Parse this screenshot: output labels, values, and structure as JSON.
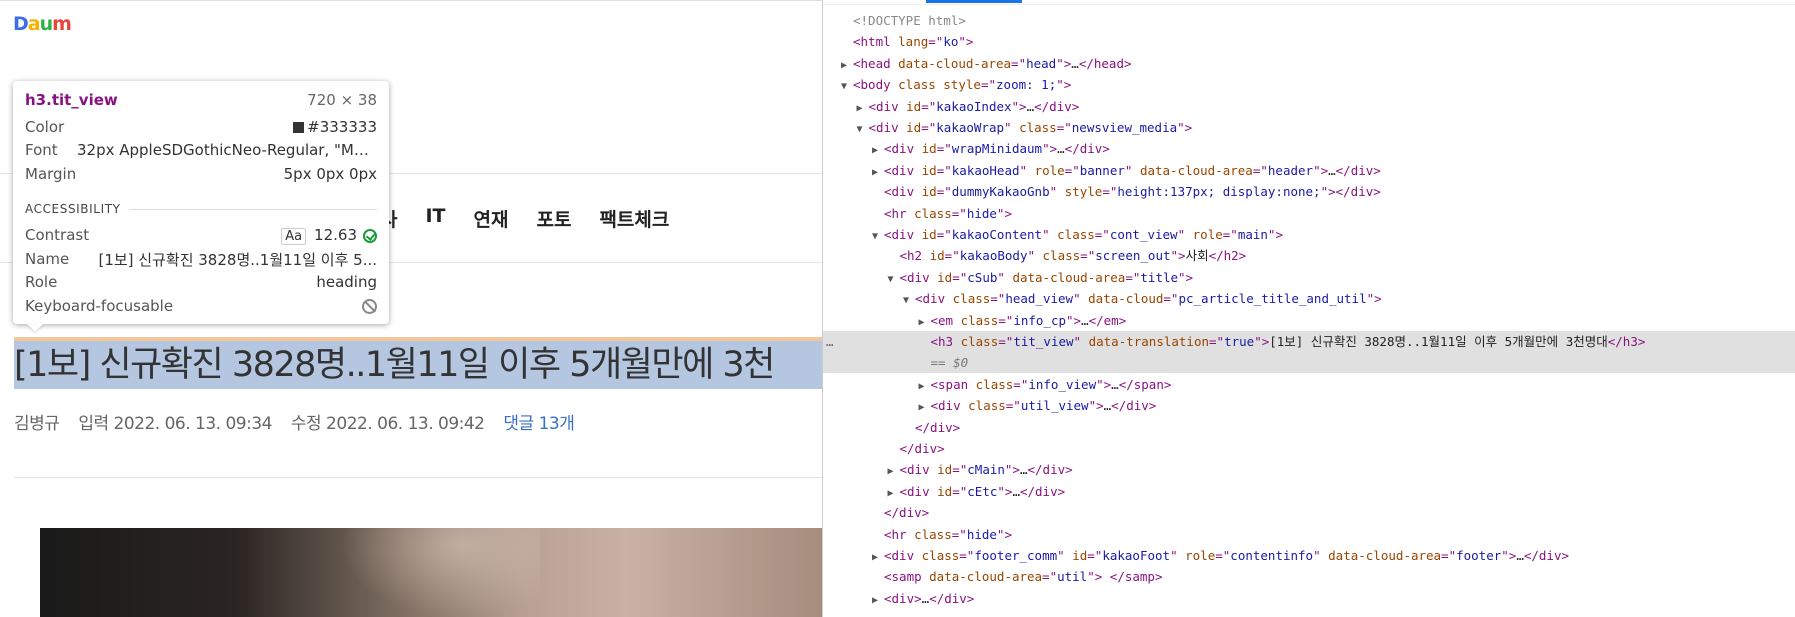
{
  "page": {
    "logo_letters": [
      "D",
      "a",
      "u",
      "m"
    ],
    "logo_colors": [
      "#3a6fe8",
      "#f5b100",
      "#2ab34a",
      "#e8453c"
    ],
    "nav": [
      "사",
      "IT",
      "연재",
      "포토",
      "팩트체크"
    ],
    "headline": "[1보] 신규확진 3828명..1월11일 이후 5개월만에 3천",
    "info": {
      "author": "김병규",
      "input": "입력 2022. 06. 13. 09:34",
      "modified": "수정 2022. 06. 13. 09:42",
      "comments": "댓글 13개"
    }
  },
  "tooltip": {
    "selector": "h3.tit_view",
    "size": "720 × 38",
    "color_label": "Color",
    "color_value": "#333333",
    "font_label": "Font",
    "font_value": "32px AppleSDGothicNeo-Regular, \"Malg...",
    "margin_label": "Margin",
    "margin_value": "5px 0px 0px",
    "accessibility_heading": "ACCESSIBILITY",
    "contrast_label": "Contrast",
    "contrast_aa": "Aa",
    "contrast_value": "12.63",
    "name_label": "Name",
    "name_value": "[1보] 신규확진 3828명..1월11일 이후 5...",
    "role_label": "Role",
    "role_value": "heading",
    "keyboard_label": "Keyboard-focusable"
  },
  "devtools": {
    "lines": [
      {
        "indent": 0,
        "tri": "",
        "parts": [
          [
            "cmt",
            "<!DOCTYPE html>"
          ]
        ]
      },
      {
        "indent": 0,
        "tri": "",
        "parts": [
          [
            "tag",
            "<html "
          ],
          [
            "attr",
            "lang"
          ],
          [
            "tag",
            "=\""
          ],
          [
            "val",
            "ko"
          ],
          [
            "tag",
            "\">"
          ]
        ]
      },
      {
        "indent": 0,
        "tri": "▶",
        "parts": [
          [
            "tag",
            "<head "
          ],
          [
            "attr",
            "data-cloud-area"
          ],
          [
            "tag",
            "=\""
          ],
          [
            "val",
            "head"
          ],
          [
            "tag",
            "\">"
          ],
          [
            "txt",
            "…"
          ],
          [
            "tag",
            "</head>"
          ]
        ]
      },
      {
        "indent": 0,
        "tri": "▼",
        "parts": [
          [
            "tag",
            "<body "
          ],
          [
            "attr",
            "class style"
          ],
          [
            "tag",
            "=\""
          ],
          [
            "val",
            "zoom: 1;"
          ],
          [
            "tag",
            "\">"
          ]
        ]
      },
      {
        "indent": 1,
        "tri": "▶",
        "parts": [
          [
            "tag",
            "<div "
          ],
          [
            "attr",
            "id"
          ],
          [
            "tag",
            "=\""
          ],
          [
            "val",
            "kakaoIndex"
          ],
          [
            "tag",
            "\">"
          ],
          [
            "txt",
            "…"
          ],
          [
            "tag",
            "</div>"
          ]
        ]
      },
      {
        "indent": 1,
        "tri": "▼",
        "parts": [
          [
            "tag",
            "<div "
          ],
          [
            "attr",
            "id"
          ],
          [
            "tag",
            "=\""
          ],
          [
            "val",
            "kakaoWrap"
          ],
          [
            "tag",
            "\" "
          ],
          [
            "attr",
            "class"
          ],
          [
            "tag",
            "=\""
          ],
          [
            "val",
            "newsview_media"
          ],
          [
            "tag",
            "\">"
          ]
        ]
      },
      {
        "indent": 2,
        "tri": "▶",
        "parts": [
          [
            "tag",
            "<div "
          ],
          [
            "attr",
            "id"
          ],
          [
            "tag",
            "=\""
          ],
          [
            "val",
            "wrapMinidaum"
          ],
          [
            "tag",
            "\">"
          ],
          [
            "txt",
            "…"
          ],
          [
            "tag",
            "</div>"
          ]
        ]
      },
      {
        "indent": 2,
        "tri": "▶",
        "parts": [
          [
            "tag",
            "<div "
          ],
          [
            "attr",
            "id"
          ],
          [
            "tag",
            "=\""
          ],
          [
            "val",
            "kakaoHead"
          ],
          [
            "tag",
            "\" "
          ],
          [
            "attr",
            "role"
          ],
          [
            "tag",
            "=\""
          ],
          [
            "val",
            "banner"
          ],
          [
            "tag",
            "\" "
          ],
          [
            "attr",
            "data-cloud-area"
          ],
          [
            "tag",
            "=\""
          ],
          [
            "val",
            "header"
          ],
          [
            "tag",
            "\">"
          ],
          [
            "txt",
            "…"
          ],
          [
            "tag",
            "</div>"
          ]
        ]
      },
      {
        "indent": 2,
        "tri": "",
        "parts": [
          [
            "tag",
            "<div "
          ],
          [
            "attr",
            "id"
          ],
          [
            "tag",
            "=\""
          ],
          [
            "val",
            "dummyKakaoGnb"
          ],
          [
            "tag",
            "\" "
          ],
          [
            "attr",
            "style"
          ],
          [
            "tag",
            "=\""
          ],
          [
            "val",
            "height:137px; display:none;"
          ],
          [
            "tag",
            "\"></div>"
          ]
        ]
      },
      {
        "indent": 2,
        "tri": "",
        "parts": [
          [
            "tag",
            "<hr "
          ],
          [
            "attr",
            "class"
          ],
          [
            "tag",
            "=\""
          ],
          [
            "val",
            "hide"
          ],
          [
            "tag",
            "\">"
          ]
        ]
      },
      {
        "indent": 2,
        "tri": "▼",
        "parts": [
          [
            "tag",
            "<div "
          ],
          [
            "attr",
            "id"
          ],
          [
            "tag",
            "=\""
          ],
          [
            "val",
            "kakaoContent"
          ],
          [
            "tag",
            "\" "
          ],
          [
            "attr",
            "class"
          ],
          [
            "tag",
            "=\""
          ],
          [
            "val",
            "cont_view"
          ],
          [
            "tag",
            "\" "
          ],
          [
            "attr",
            "role"
          ],
          [
            "tag",
            "=\""
          ],
          [
            "val",
            "main"
          ],
          [
            "tag",
            "\">"
          ]
        ]
      },
      {
        "indent": 3,
        "tri": "",
        "parts": [
          [
            "tag",
            "<h2 "
          ],
          [
            "attr",
            "id"
          ],
          [
            "tag",
            "=\""
          ],
          [
            "val",
            "kakaoBody"
          ],
          [
            "tag",
            "\" "
          ],
          [
            "attr",
            "class"
          ],
          [
            "tag",
            "=\""
          ],
          [
            "val",
            "screen_out"
          ],
          [
            "tag",
            "\">"
          ],
          [
            "txt",
            "사회"
          ],
          [
            "tag",
            "</h2>"
          ]
        ]
      },
      {
        "indent": 3,
        "tri": "▼",
        "parts": [
          [
            "tag",
            "<div "
          ],
          [
            "attr",
            "id"
          ],
          [
            "tag",
            "=\""
          ],
          [
            "val",
            "cSub"
          ],
          [
            "tag",
            "\" "
          ],
          [
            "attr",
            "data-cloud-area"
          ],
          [
            "tag",
            "=\""
          ],
          [
            "val",
            "title"
          ],
          [
            "tag",
            "\">"
          ]
        ]
      },
      {
        "indent": 4,
        "tri": "▼",
        "parts": [
          [
            "tag",
            "<div "
          ],
          [
            "attr",
            "class"
          ],
          [
            "tag",
            "=\""
          ],
          [
            "val",
            "head_view"
          ],
          [
            "tag",
            "\" "
          ],
          [
            "attr",
            "data-cloud"
          ],
          [
            "tag",
            "=\""
          ],
          [
            "val",
            "pc_article_title_and_util"
          ],
          [
            "tag",
            "\">"
          ]
        ]
      },
      {
        "indent": 5,
        "tri": "▶",
        "parts": [
          [
            "tag",
            "<em "
          ],
          [
            "attr",
            "class"
          ],
          [
            "tag",
            "=\""
          ],
          [
            "val",
            "info_cp"
          ],
          [
            "tag",
            "\">"
          ],
          [
            "txt",
            "…"
          ],
          [
            "tag",
            "</em>"
          ]
        ]
      },
      {
        "indent": 5,
        "tri": "",
        "sel": true,
        "parts": [
          [
            "tag",
            "<h3 "
          ],
          [
            "attr",
            "class"
          ],
          [
            "tag",
            "=\""
          ],
          [
            "val",
            "tit_view"
          ],
          [
            "tag",
            "\" "
          ],
          [
            "attr",
            "data-translation"
          ],
          [
            "tag",
            "=\""
          ],
          [
            "val",
            "true"
          ],
          [
            "tag",
            "\">"
          ],
          [
            "txt",
            "[1보] 신규확진 3828명..1월11일 이후 5개월만에 3천명대"
          ],
          [
            "tag",
            "</h3>"
          ]
        ]
      },
      {
        "indent": 5,
        "tri": "",
        "sel": true,
        "parts": [
          [
            "dollar",
            "== $0"
          ]
        ]
      },
      {
        "indent": 5,
        "tri": "▶",
        "parts": [
          [
            "tag",
            "<span "
          ],
          [
            "attr",
            "class"
          ],
          [
            "tag",
            "=\""
          ],
          [
            "val",
            "info_view"
          ],
          [
            "tag",
            "\">"
          ],
          [
            "txt",
            "…"
          ],
          [
            "tag",
            "</span>"
          ]
        ]
      },
      {
        "indent": 5,
        "tri": "▶",
        "parts": [
          [
            "tag",
            "<div "
          ],
          [
            "attr",
            "class"
          ],
          [
            "tag",
            "=\""
          ],
          [
            "val",
            "util_view"
          ],
          [
            "tag",
            "\">"
          ],
          [
            "txt",
            "…"
          ],
          [
            "tag",
            "</div>"
          ]
        ]
      },
      {
        "indent": 4,
        "tri": "",
        "parts": [
          [
            "tag",
            "</div>"
          ]
        ]
      },
      {
        "indent": 3,
        "tri": "",
        "parts": [
          [
            "tag",
            "</div>"
          ]
        ]
      },
      {
        "indent": 3,
        "tri": "▶",
        "parts": [
          [
            "tag",
            "<div "
          ],
          [
            "attr",
            "id"
          ],
          [
            "tag",
            "=\""
          ],
          [
            "val",
            "cMain"
          ],
          [
            "tag",
            "\">"
          ],
          [
            "txt",
            "…"
          ],
          [
            "tag",
            "</div>"
          ]
        ]
      },
      {
        "indent": 3,
        "tri": "▶",
        "parts": [
          [
            "tag",
            "<div "
          ],
          [
            "attr",
            "id"
          ],
          [
            "tag",
            "=\""
          ],
          [
            "val",
            "cEtc"
          ],
          [
            "tag",
            "\">"
          ],
          [
            "txt",
            "…"
          ],
          [
            "tag",
            "</div>"
          ]
        ]
      },
      {
        "indent": 2,
        "tri": "",
        "parts": [
          [
            "tag",
            "</div>"
          ]
        ]
      },
      {
        "indent": 2,
        "tri": "",
        "parts": [
          [
            "tag",
            "<hr "
          ],
          [
            "attr",
            "class"
          ],
          [
            "tag",
            "=\""
          ],
          [
            "val",
            "hide"
          ],
          [
            "tag",
            "\">"
          ]
        ]
      },
      {
        "indent": 2,
        "tri": "▶",
        "parts": [
          [
            "tag",
            "<div "
          ],
          [
            "attr",
            "class"
          ],
          [
            "tag",
            "=\""
          ],
          [
            "val",
            "footer_comm"
          ],
          [
            "tag",
            "\" "
          ],
          [
            "attr",
            "id"
          ],
          [
            "tag",
            "=\""
          ],
          [
            "val",
            "kakaoFoot"
          ],
          [
            "tag",
            "\" "
          ],
          [
            "attr",
            "role"
          ],
          [
            "tag",
            "=\""
          ],
          [
            "val",
            "contentinfo"
          ],
          [
            "tag",
            "\" "
          ],
          [
            "attr",
            "data-cloud-area"
          ],
          [
            "tag",
            "=\""
          ],
          [
            "val",
            "footer"
          ],
          [
            "tag",
            "\">"
          ],
          [
            "txt",
            "…"
          ],
          [
            "tag",
            "</div>"
          ]
        ]
      },
      {
        "indent": 2,
        "tri": "",
        "parts": [
          [
            "tag",
            "<samp "
          ],
          [
            "attr",
            "data-cloud-area"
          ],
          [
            "tag",
            "=\""
          ],
          [
            "val",
            "util"
          ],
          [
            "tag",
            "\"> </samp>"
          ]
        ]
      },
      {
        "indent": 2,
        "tri": "▶",
        "parts": [
          [
            "tag",
            "<div>"
          ],
          [
            "txt",
            "…"
          ],
          [
            "tag",
            "</div>"
          ]
        ]
      }
    ]
  }
}
